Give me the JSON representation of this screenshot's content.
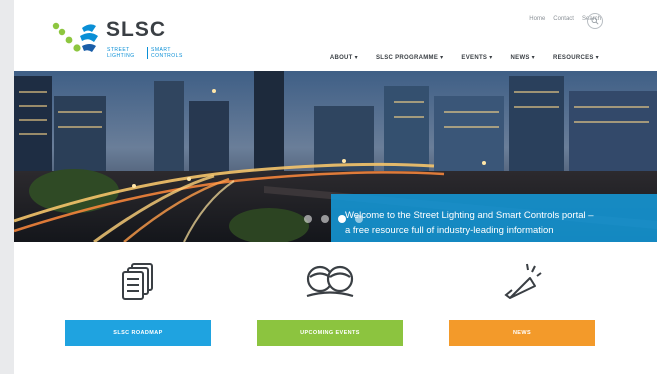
{
  "brand": {
    "name": "SLSC",
    "sub_col1": [
      "STREET",
      "LIGHTING"
    ],
    "sub_col2": [
      "SMART",
      "CONTROLS"
    ],
    "dot_colors": [
      "#8dc63f",
      "#0a8fd6",
      "#1a5ea8"
    ]
  },
  "utility_nav": [
    "Home",
    "Contact",
    "Search"
  ],
  "search_icon": "search-icon",
  "main_nav": [
    {
      "label": "ABOUT ▾"
    },
    {
      "label": "SLSC PROGRAMME ▾"
    },
    {
      "label": "EVENTS ▾"
    },
    {
      "label": "NEWS ▾"
    },
    {
      "label": "RESOURCES ▾"
    }
  ],
  "hero": {
    "caption_line1": "Welcome to the Street Lighting and Smart Controls portal –",
    "caption_line2": "a free resource full of industry-leading information",
    "slide_count": 4,
    "active_slide": 3
  },
  "features": [
    {
      "label": "SLSC ROADMAP",
      "color": "#1fa3e0",
      "icon": "documents-icon"
    },
    {
      "label": "UPCOMING EVENTS",
      "color": "#8cc43f",
      "icon": "people-icon"
    },
    {
      "label": "NEWS",
      "color": "#f39a2a",
      "icon": "megaphone-icon"
    }
  ]
}
